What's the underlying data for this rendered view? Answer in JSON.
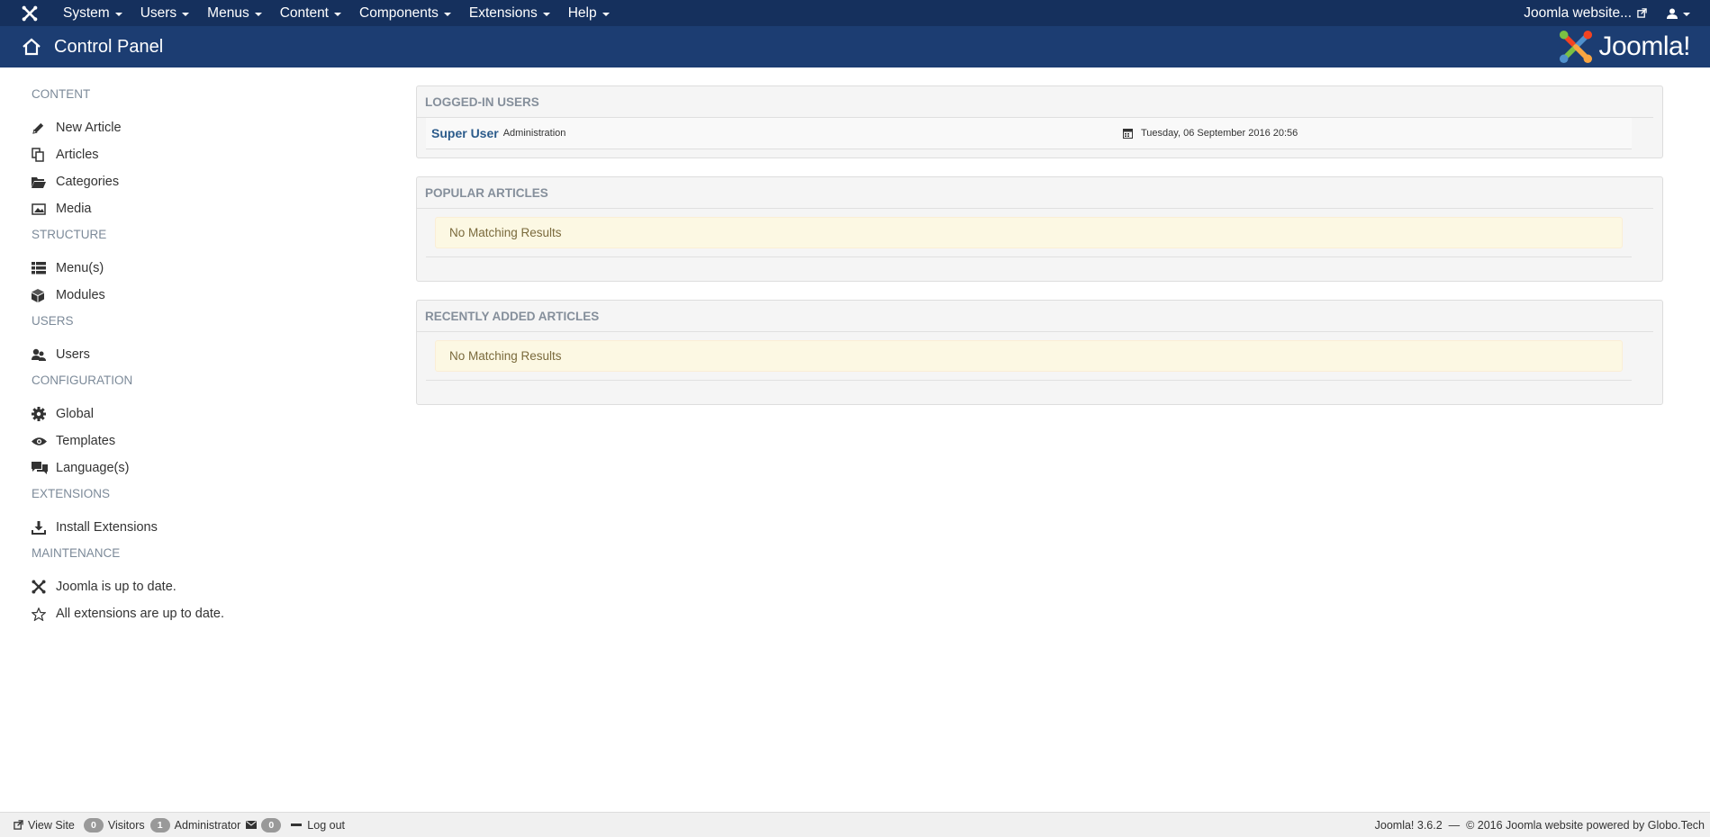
{
  "topnav": {
    "menu": [
      {
        "label": "System"
      },
      {
        "label": "Users"
      },
      {
        "label": "Menus"
      },
      {
        "label": "Content"
      },
      {
        "label": "Components"
      },
      {
        "label": "Extensions"
      },
      {
        "label": "Help"
      }
    ],
    "site_link": "Joomla website..."
  },
  "header": {
    "title": "Control Panel",
    "logo_text": "Joomla!"
  },
  "sidebar": {
    "content": {
      "heading": "CONTENT",
      "items": [
        {
          "label": "New Article",
          "icon": "pencil-icon"
        },
        {
          "label": "Articles",
          "icon": "copy-icon"
        },
        {
          "label": "Categories",
          "icon": "folder-icon"
        },
        {
          "label": "Media",
          "icon": "image-icon"
        }
      ]
    },
    "structure": {
      "heading": "STRUCTURE",
      "items": [
        {
          "label": "Menu(s)",
          "icon": "list-icon"
        },
        {
          "label": "Modules",
          "icon": "cube-icon"
        }
      ]
    },
    "users": {
      "heading": "USERS",
      "items": [
        {
          "label": "Users",
          "icon": "users-icon"
        }
      ]
    },
    "configuration": {
      "heading": "CONFIGURATION",
      "items": [
        {
          "label": "Global",
          "icon": "gear-icon"
        },
        {
          "label": "Templates",
          "icon": "eye-icon"
        },
        {
          "label": "Language(s)",
          "icon": "comments-icon"
        }
      ]
    },
    "extensions": {
      "heading": "EXTENSIONS",
      "items": [
        {
          "label": "Install Extensions",
          "icon": "download-icon"
        }
      ]
    },
    "maintenance": {
      "heading": "MAINTENANCE",
      "items": [
        {
          "label": "Joomla is up to date.",
          "icon": "joomla-icon"
        },
        {
          "label": "All extensions are up to date.",
          "icon": "star-icon"
        }
      ]
    }
  },
  "modules": {
    "logged_in": {
      "title": "LOGGED-IN USERS",
      "user_name": "Super User",
      "user_role": "Administration",
      "date": "Tuesday, 06 September 2016 20:56"
    },
    "popular": {
      "title": "POPULAR ARTICLES",
      "message": "No Matching Results"
    },
    "recent": {
      "title": "RECENTLY ADDED ARTICLES",
      "message": "No Matching Results"
    }
  },
  "footer": {
    "view_site": "View Site",
    "visitors_count": "0",
    "visitors_label": "Visitors",
    "admin_count": "1",
    "admin_label": "Administrator",
    "messages_count": "0",
    "logout_label": "Log out",
    "copyright": "Joomla! 3.6.2  —  © 2016 Joomla website powered by Globo.Tech"
  },
  "colors": {
    "topnav_bg": "#15305d",
    "header_bg": "#1c3d72",
    "link_blue": "#2b5b8b",
    "alert_bg": "#fcf8e3"
  }
}
